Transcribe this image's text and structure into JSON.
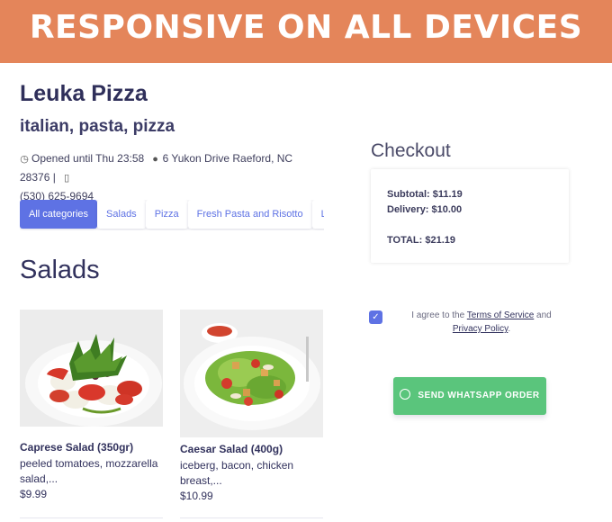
{
  "banner": {
    "title": "RESPONSIVE ON ALL DEVICES"
  },
  "shop": {
    "name": "Leuka Pizza",
    "tags": "italian, pasta, pizza",
    "hours": "Opened until Thu 23:58",
    "address": "6 Yukon Drive Raeford, NC 28376 |",
    "phone": "(530) 625-9694"
  },
  "categories": [
    {
      "label": "All categories",
      "active": true
    },
    {
      "label": "Salads"
    },
    {
      "label": "Pizza"
    },
    {
      "label": "Fresh Pasta and Risotto"
    },
    {
      "label": "Lasagna"
    }
  ],
  "section": {
    "title": "Salads"
  },
  "items": [
    {
      "name": "Caprese Salad (350gr)",
      "desc_line1": "peeled tomatoes, mozzarella",
      "desc_line2": "salad,...",
      "price": "$9.99"
    },
    {
      "name": "Caesar Salad (400g)",
      "desc_line1": "iceberg, bacon, chicken",
      "desc_line2": "breast,...",
      "price": "$10.99"
    }
  ],
  "checkout": {
    "title": "Checkout",
    "subtotal": "Subtotal: $11.19",
    "delivery": "Delivery: $10.00",
    "total": "TOTAL: $21.19"
  },
  "agree": {
    "prefix": "I agree to the",
    "terms": "Terms of Service",
    "and": "and",
    "privacy": "Privacy Policy",
    "suffix": ".",
    "checked": true
  },
  "order_button": {
    "label": "SEND WHATSAPP ORDER"
  },
  "colors": {
    "banner": "#e4855a",
    "accent": "#5e72e4",
    "whatsapp": "#5ac57c"
  }
}
